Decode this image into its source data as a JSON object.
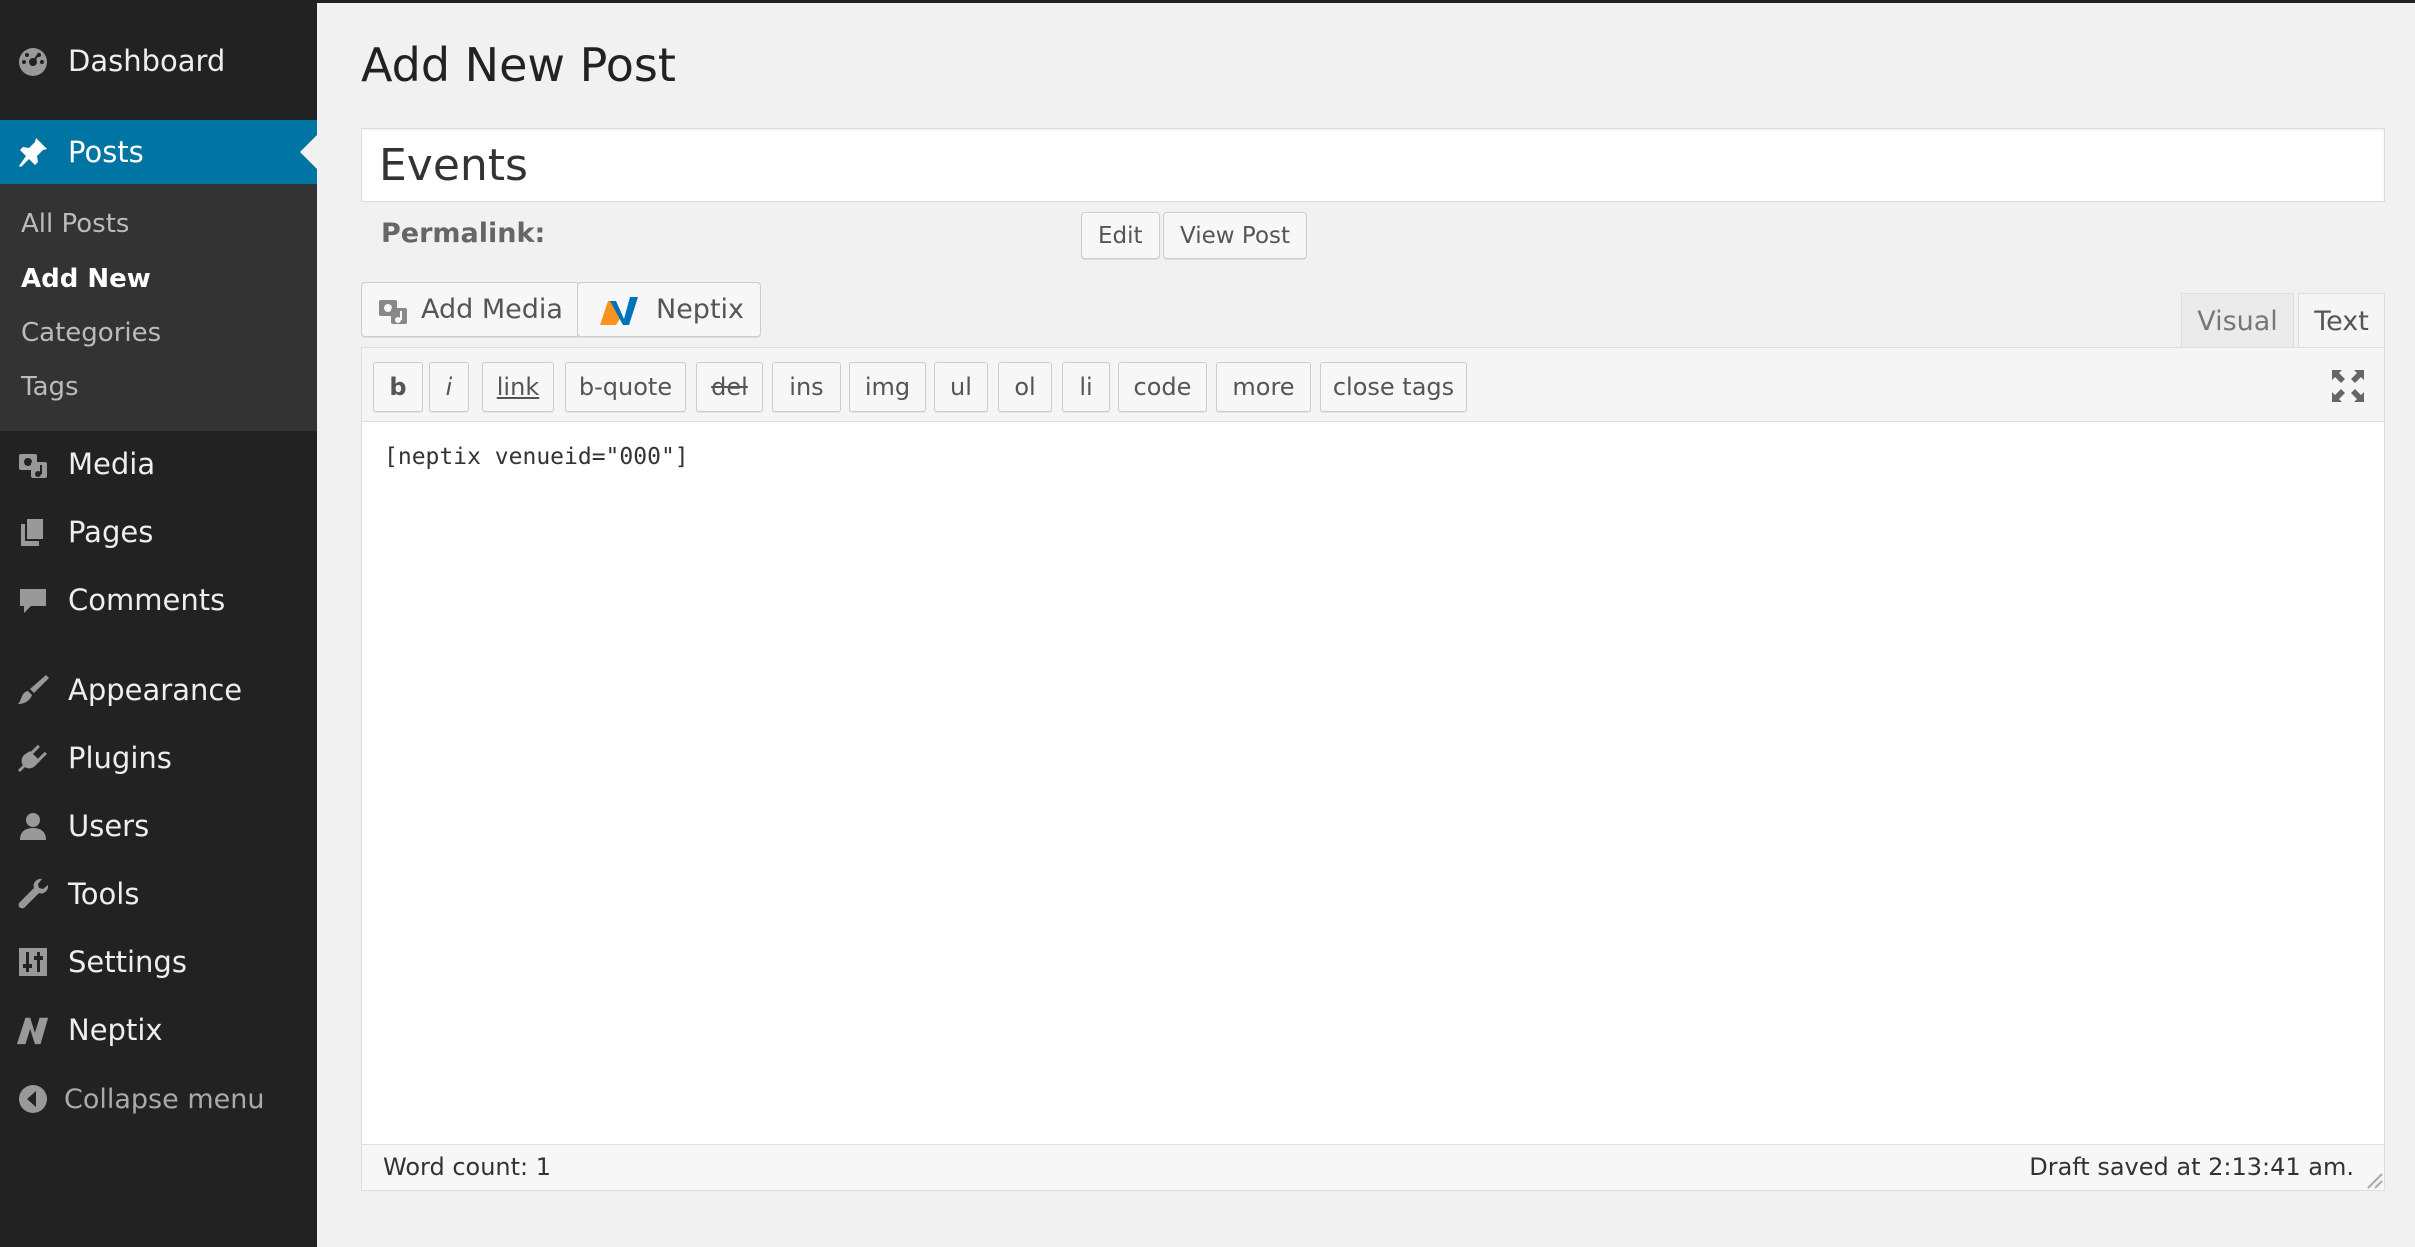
{
  "sidebar": {
    "items": [
      {
        "id": "dashboard",
        "label": "Dashboard",
        "icon": "dashboard-icon"
      },
      {
        "id": "posts",
        "label": "Posts",
        "icon": "pin-icon",
        "active": true
      },
      {
        "id": "media",
        "label": "Media",
        "icon": "media-icon"
      },
      {
        "id": "pages",
        "label": "Pages",
        "icon": "pages-icon"
      },
      {
        "id": "comments",
        "label": "Comments",
        "icon": "comment-icon"
      },
      {
        "id": "appearance",
        "label": "Appearance",
        "icon": "paintbrush-icon"
      },
      {
        "id": "plugins",
        "label": "Plugins",
        "icon": "plug-icon"
      },
      {
        "id": "users",
        "label": "Users",
        "icon": "user-icon"
      },
      {
        "id": "tools",
        "label": "Tools",
        "icon": "wrench-icon"
      },
      {
        "id": "settings",
        "label": "Settings",
        "icon": "sliders-icon"
      },
      {
        "id": "neptix",
        "label": "Neptix",
        "icon": "neptix-logo-icon"
      }
    ],
    "submenu": [
      {
        "label": "All Posts"
      },
      {
        "label": "Add New",
        "current": true
      },
      {
        "label": "Categories"
      },
      {
        "label": "Tags"
      }
    ],
    "collapse_label": "Collapse menu"
  },
  "page": {
    "title": "Add New Post",
    "post_title_value": "Events",
    "permalink_label": "Permalink:",
    "edit_label": "Edit",
    "view_post_label": "View Post",
    "add_media_label": "Add Media",
    "neptix_label": "Neptix"
  },
  "editor": {
    "tabs": [
      {
        "label": "Visual",
        "active": false
      },
      {
        "label": "Text",
        "active": true
      }
    ],
    "quicktags": [
      "b",
      "i",
      "link",
      "b-quote",
      "del",
      "ins",
      "img",
      "ul",
      "ol",
      "li",
      "code",
      "more",
      "close tags"
    ],
    "content": "[neptix venueid=\"000\"]",
    "word_count": "Word count: 1",
    "draft_status": "Draft saved at 2:13:41 am."
  },
  "colors": {
    "sidebar_bg": "#222222",
    "submenu_bg": "#333333",
    "active_blue": "#0074a2",
    "page_bg": "#f1f1f1",
    "neptix_orange": "#f7941d",
    "neptix_blue": "#0072bc"
  }
}
